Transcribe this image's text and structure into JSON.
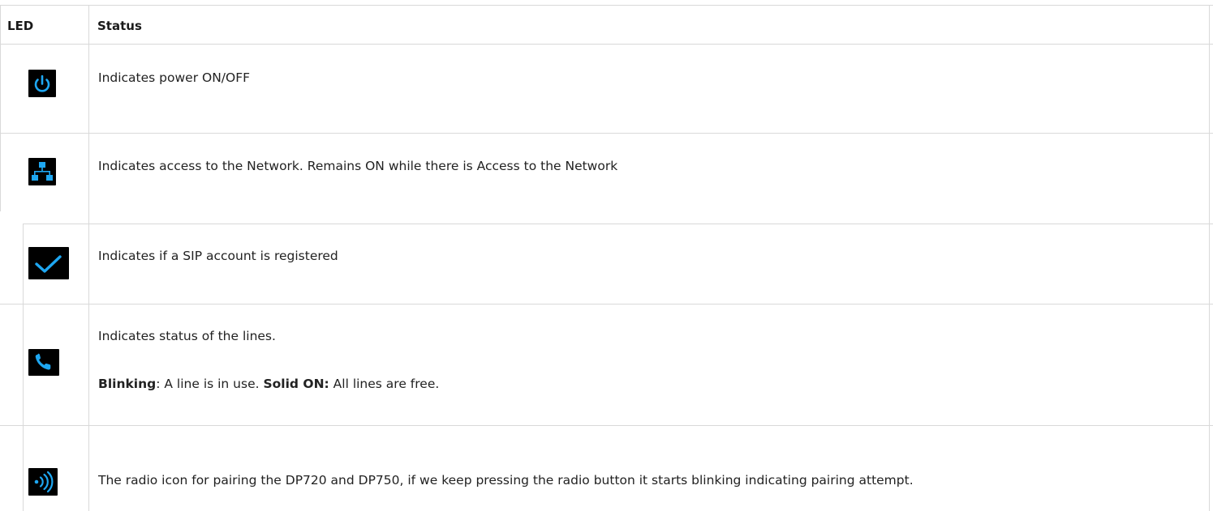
{
  "table": {
    "headers": {
      "led": "LED",
      "status": "Status"
    },
    "rows": [
      {
        "icon": "power-icon",
        "status": "Indicates power ON/OFF"
      },
      {
        "icon": "network-icon",
        "status": "Indicates access to the Network. Remains ON while there is Access to the Network"
      },
      {
        "icon": "checkmark-icon",
        "status": "Indicates if a SIP account is registered"
      },
      {
        "icon": "phone-icon",
        "status": "Indicates status of the lines.",
        "detail": {
          "blinking_label": "Blinking",
          "blinking_text": ": A line is in use. ",
          "solid_label": "Solid ON:",
          "solid_text": " All lines are free."
        }
      },
      {
        "icon": "radio-icon",
        "status": "The radio icon for pairing the DP720 and DP750, if we keep pressing the radio button it starts blinking indicating pairing attempt."
      }
    ]
  },
  "colors": {
    "led_background": "#000000",
    "led_glyph": "#1ea7f2",
    "border": "#d9d9d9",
    "text": "#222222"
  }
}
